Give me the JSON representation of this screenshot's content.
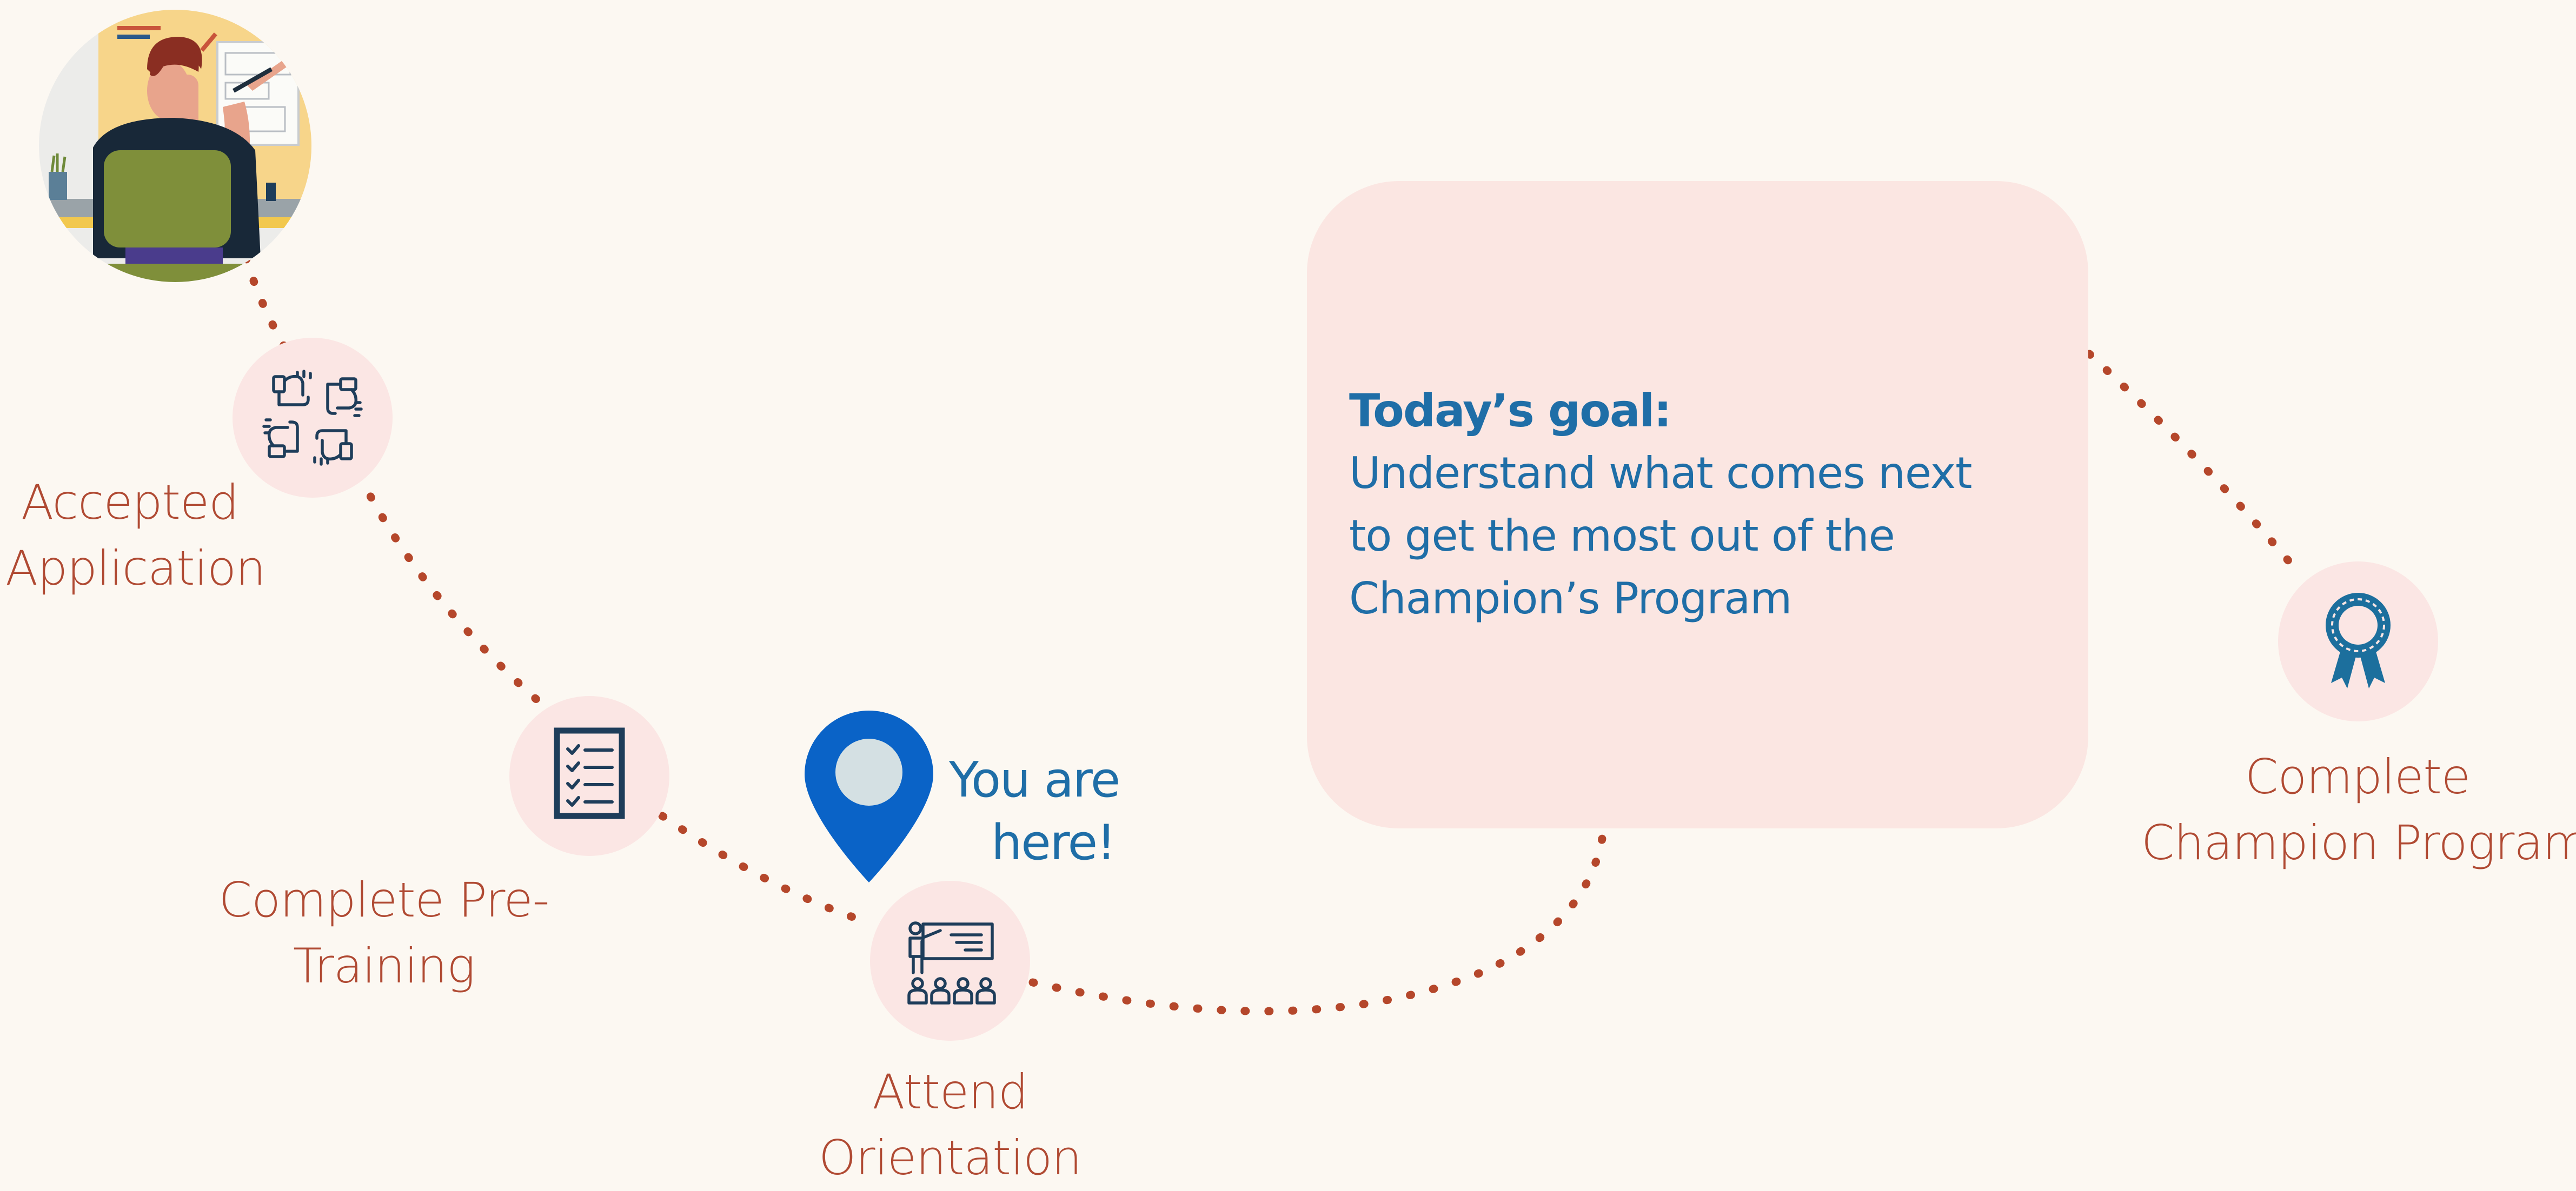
{
  "journey": {
    "steps": [
      {
        "id": "accepted",
        "label_lines": [
          "Accepted",
          "Application"
        ],
        "icon": "hands-teamwork-icon"
      },
      {
        "id": "pretraining",
        "label_lines": [
          "Complete Pre-",
          "Training"
        ],
        "icon": "checklist-icon"
      },
      {
        "id": "orientation",
        "label_lines": [
          "Attend",
          "Orientation"
        ],
        "icon": "presentation-icon"
      },
      {
        "id": "champion",
        "label_lines": [
          "Complete",
          "Champion Program"
        ],
        "icon": "award-ribbon-icon"
      }
    ],
    "marker": {
      "label_lines": [
        "You are",
        "here!"
      ],
      "icon": "location-pin-icon"
    },
    "goal": {
      "title": "Today’s goal:",
      "lines": [
        "Understand what comes next",
        "to get the most out of the",
        "Champion’s Program"
      ]
    },
    "colors": {
      "background": "#fcf8f2",
      "step_circle": "#fbe6e4",
      "goal_box": "#fbe6e2",
      "path": "#b5472b",
      "label_text": "#b04a33",
      "goal_text": "#1f6ea7",
      "pin": "#0a63c7",
      "icon_dark": "#1e3d5a",
      "award": "#1c6f9d"
    }
  }
}
